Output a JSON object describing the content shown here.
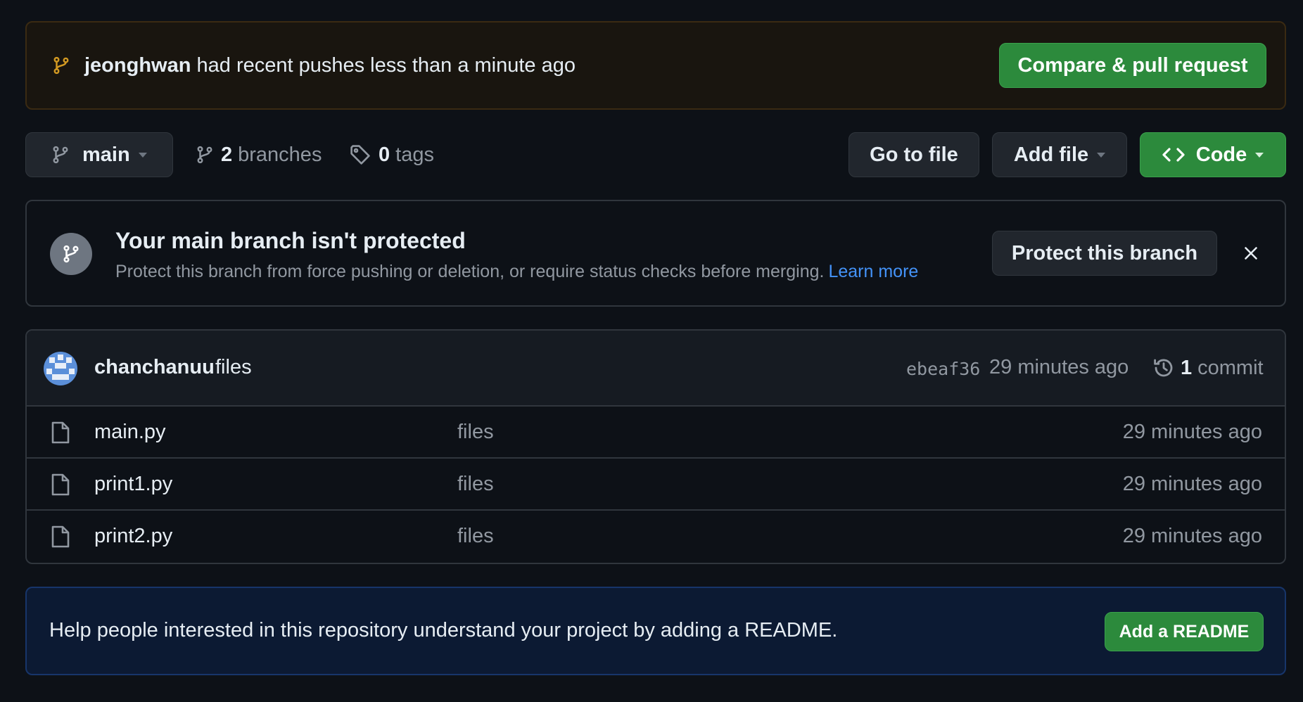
{
  "push_banner": {
    "user": "jeonghwan",
    "message": "had recent pushes less than a minute ago",
    "button_label": "Compare & pull request"
  },
  "toolbar": {
    "branch": "main",
    "branches_count": "2",
    "branches_label": "branches",
    "tags_count": "0",
    "tags_label": "tags",
    "go_to_file": "Go to file",
    "add_file": "Add file",
    "code": "Code"
  },
  "protect_banner": {
    "title": "Your main branch isn't protected",
    "description": "Protect this branch from force pushing or deletion, or require status checks before merging.",
    "learn_more": "Learn more",
    "button_label": "Protect this branch"
  },
  "latest_commit": {
    "author": "chanchanuu",
    "message": "files",
    "sha": "ebeaf36",
    "time": "29 minutes ago",
    "commit_count": "1",
    "commit_label": "commit"
  },
  "files": [
    {
      "name": "main.py",
      "message": "files",
      "time": "29 minutes ago"
    },
    {
      "name": "print1.py",
      "message": "files",
      "time": "29 minutes ago"
    },
    {
      "name": "print2.py",
      "message": "files",
      "time": "29 minutes ago"
    }
  ],
  "readme_banner": {
    "text": "Help people interested in this repository understand your project by adding a README.",
    "button_label": "Add a README"
  },
  "colors": {
    "background": "#0d1117",
    "green_button": "#2c8a3c",
    "link_blue": "#4493f8",
    "muted_text": "#9198a1"
  }
}
